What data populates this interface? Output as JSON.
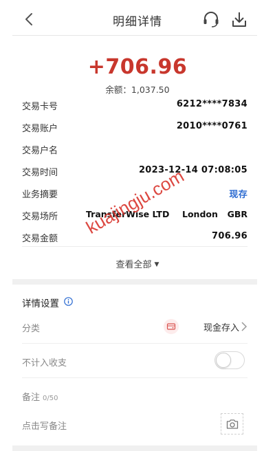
{
  "header": {
    "title": "明细详情"
  },
  "summary": {
    "amount": "+706.96",
    "balance": "余额：1,037.50"
  },
  "details": [
    {
      "label": "交易卡号",
      "value": "6212****7834"
    },
    {
      "label": "交易账户",
      "value": "2010****0761"
    },
    {
      "label": "交易户名",
      "value": ""
    },
    {
      "label": "交易时间",
      "value": "2023-12-14 07:08:05"
    },
    {
      "label": "业务摘要",
      "value": "现存"
    },
    {
      "label": "交易场所",
      "value": ""
    },
    {
      "label": "交易金额",
      "value": "706.96"
    }
  ],
  "place": {
    "merchant": "TransferWise LTD",
    "city": "London",
    "country": "GBR"
  },
  "view_all": "查看全部",
  "settings": {
    "title": "详情设置",
    "category_label": "分类",
    "category_value": "现金存入",
    "exclude_label": "不计入收支",
    "exclude_on": false,
    "note_label": "备注",
    "note_counter": "0/50",
    "note_placeholder": "点击写备注"
  },
  "watermark": "kuajingju.com",
  "colors": {
    "amount": "#c8372d",
    "link": "#2c6bd1",
    "watermark": "#d9352d"
  }
}
